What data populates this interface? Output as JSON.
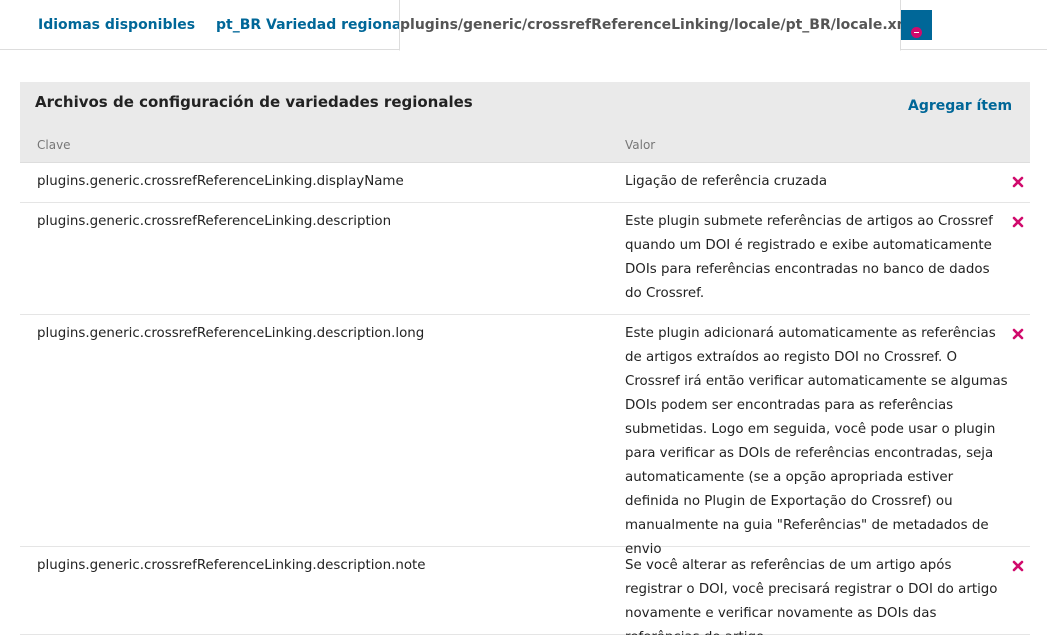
{
  "tabs": {
    "available_languages": "Idiomas disponibles",
    "regional_variety": "pt_BR Variedad regional",
    "active_file": "plugins/generic/crossrefReferenceLinking/locale/pt_BR/locale.xml"
  },
  "panel": {
    "title": "Archivos de configuración de variedades regionales",
    "add_item": "Agregar ítem",
    "col_key": "Clave",
    "col_value": "Valor"
  },
  "rows": [
    {
      "key": "plugins.generic.crossrefReferenceLinking.displayName",
      "value": "Ligação de referência cruzada"
    },
    {
      "key": "plugins.generic.crossrefReferenceLinking.description",
      "value": "Este plugin submete referências de artigos ao Crossref quando um DOI é registrado e exibe automaticamente DOIs para referências encontradas no banco de dados do Crossref."
    },
    {
      "key": "plugins.generic.crossrefReferenceLinking.description.long",
      "value": "Este plugin adicionará automaticamente as referências de artigos extraídos ao registo DOI no Crossref. O Crossref irá então verificar automaticamente se algumas DOIs podem ser encontradas para as referências submetidas. Logo em seguida, você pode usar o plugin para verificar as DOIs de referências encontradas, seja automaticamente (se a opção apropriada estiver definida no Plugin de Exportação do Crossref) ou manualmente na guia \"Referências\" de metadados de envio"
    },
    {
      "key": "plugins.generic.crossrefReferenceLinking.description.note",
      "value": "Se você alterar as referências de um artigo após registrar o DOI, você precisará registrar o DOI do artigo novamente e verificar novamente as DOIs das referências do artigo."
    }
  ],
  "colors": {
    "link": "#006798",
    "delete": "#d00a6c",
    "header_bg": "#eaeaea"
  },
  "icons": {
    "tab_close": "minus-circle-icon",
    "row_delete": "delete-x-icon"
  }
}
